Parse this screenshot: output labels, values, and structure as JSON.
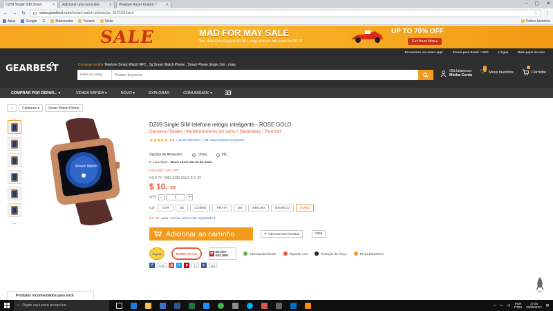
{
  "browser": {
    "tabs": [
      {
        "label": "DZ09 Single SIM Smart",
        "fav": "#1a73e8",
        "active": true
      },
      {
        "label": "Adicionar uma nova dire",
        "fav": "#f29b1c",
        "active": false
      },
      {
        "label": "Headset Razer Kraken 7",
        "fav": "#f29b1c",
        "active": false
      }
    ],
    "url_host": "www.gearbest.com",
    "url_path": "/smart-watch-phone/pp_317102.html",
    "bookmarks": [
      "Apps",
      "Google",
      "G",
      "Marcenaria",
      "Tucson",
      "Visão"
    ],
    "bookmarks_right": "Outros favoritos"
  },
  "banner": {
    "sale_word": "SALE",
    "headline": "MAD FOR MAY SALE",
    "subline": "Coo: Add-One Payjust $3.99   Lucky draw to win prize for $0.01",
    "upto": "UP TO 70% OFF",
    "cta": "Get Yours Now ▸"
  },
  "topbar": {
    "app": "Economize no nosso app!",
    "ship": "Enviar para Brasil / USD",
    "lang": "Língua",
    "help": "Bate-papo ao vivo"
  },
  "header": {
    "logo": "GEARBEST",
    "hot_label": "Compras on-line",
    "hot_terms": "Telefone Smart Watch NFC ,  3g Smart Watch Phone ,  Smart Phone Single Sim ,  mais",
    "search_category": "todas as categ...",
    "search_placeholder": "Product keywords",
    "account_line1": "Olá lalamoso",
    "account_line2": "Minha Conta",
    "favorites_label": "Meus favoritos",
    "favorites_count": "2",
    "cart_label": "Carrinho",
    "cart_count": "0"
  },
  "nav": {
    "categories": "COMPRAR POR DEPAR...",
    "items": [
      "VENDA RÁPIDA",
      "NOVO",
      "EXPLORAR",
      "COMUNIDADE"
    ],
    "brand": "ƎƎ"
  },
  "breadcrumb": [
    "Celulares",
    "Smart Watch Phone"
  ],
  "product": {
    "title": "DZ09 Single SIM telefone relógio inteligente  -  ROSE GOLD",
    "subtitle": "Camera / Dialer / Monitoramento do sono / Sedentary / Remind",
    "rating": 4.8,
    "rating_text": "4.8",
    "reviews": "( 1149 Opiniões)",
    "questions": "| 98 responderam perguntas",
    "storage_label": "Opções de Armazém:",
    "storage_options": [
      "China",
      "HK"
    ],
    "shipping_label": "E-expedição:",
    "shipping_value": "Novo envio em 24 de maio",
    "discount": "Desconto: 13% OFF",
    "original_price": "US $ 70. 00$3.99$3.99US $ 3. 99",
    "price_main": "$ 10.",
    "price_cents": "35",
    "qty_label": "QTY:",
    "qty_value": "1",
    "color_label": "Cor:",
    "colors": [
      "COR",
      "DE",
      "COBRE",
      "PRATA",
      "DE",
      "BRILHO",
      "BRANCO",
      "OURO"
    ],
    "free_price": "$ 0. 00",
    "free_text": "para",
    "free_link": "Correio aéreo não registrado ▾",
    "add_to_cart": "Adicionar ao carrinho",
    "add_fav": "Adicionar aos favoritos",
    "fav_count": "1856"
  },
  "trust": {
    "paypal": "PayPal",
    "moneyback": "MONEY BACK",
    "mcafee": "McAfee SECURE",
    "info": [
      {
        "label": "Informações fiscais",
        "color": "#5db044"
      },
      {
        "label": "Reportar erro",
        "color": "#e9583d"
      },
      {
        "label": "Proteção de Preço",
        "color": "#222"
      },
      {
        "label": "Preço Disclaimer",
        "color": "#f29b1c"
      }
    ]
  },
  "social": {
    "counts": [
      "6,0K",
      "74",
      "325"
    ]
  },
  "recommended": "Produtos recomendados para você",
  "taskbar": {
    "search": "Digite aqui para pesquisar",
    "lang": "POR",
    "layout": "PTB2",
    "time": "17:54",
    "date": "23/05/2017"
  }
}
